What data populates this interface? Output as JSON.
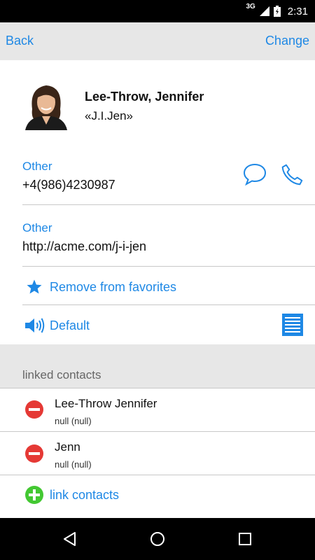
{
  "status_bar": {
    "network": "3G",
    "time": "2:31"
  },
  "toolbar": {
    "back_label": "Back",
    "change_label": "Change"
  },
  "contact": {
    "name": "Lee-Throw, Jennifer",
    "nickname": "«J.I.Jen»"
  },
  "phone": {
    "label": "Other",
    "value": "+4(986)4230987"
  },
  "url": {
    "label": "Other",
    "value": "http://acme.com/j-i-jen"
  },
  "favorites": {
    "label": "Remove from favorites"
  },
  "ringtone": {
    "label": "Default"
  },
  "linked": {
    "header": "linked contacts",
    "items": [
      {
        "name": "Lee-Throw Jennifer",
        "sub": "null (null)"
      },
      {
        "name": "Jenn",
        "sub": "null (null)"
      }
    ],
    "link_label": "link contacts"
  },
  "colors": {
    "accent": "#1e88e5",
    "remove": "#e53935",
    "add": "#43c832"
  }
}
